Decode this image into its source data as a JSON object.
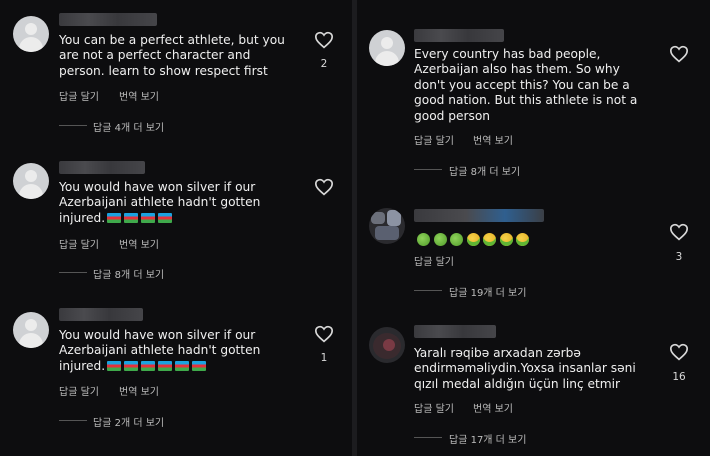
{
  "left_comments": [
    {
      "text": "You can be a perfect athlete, but you\nare not a perfect character and\nperson. learn to show respect first",
      "likes": "2",
      "reply_label": "답글 달기",
      "translate_label": "번역 보기",
      "more_replies": "답글 4개 더 보기"
    },
    {
      "text": "You would have won silver if our\nAzerbaijani athlete hadn't gotten\ninjured.",
      "flags_count": 4,
      "likes": "",
      "reply_label": "답글 달기",
      "translate_label": "번역 보기",
      "more_replies": "답글 8개 더 보기"
    },
    {
      "text": "You would have won silver if our\nAzerbaijani athlete hadn't gotten\ninjured.",
      "flags_count": 6,
      "likes": "1",
      "reply_label": "답글 달기",
      "translate_label": "번역 보기",
      "more_replies": "답글 2개 더 보기"
    }
  ],
  "right_comments": [
    {
      "text": "Every country has bad people,\nAzerbaijan also has them. So why\ndon't you accept this? You can be a\ngood nation. But this athlete is not a\ngood person",
      "likes": "",
      "reply_label": "답글 달기",
      "translate_label": "번역 보기",
      "more_replies": "답글 8개 더 보기"
    },
    {
      "emoji": [
        "green",
        "green",
        "green",
        "vomit",
        "vomit",
        "vomit",
        "vomit"
      ],
      "likes": "3",
      "reply_label": "답글 달기",
      "more_replies": "답글 19개 더 보기"
    },
    {
      "text": "Yaralı rəqibə arxadan zərbə\nendirməməliydin.Yoxsa insanlar səni\nqızıl medal aldığın üçün linç etmir",
      "likes": "16",
      "reply_label": "답글 달기",
      "translate_label": "번역 보기",
      "more_replies": "답글 17개 더 보기"
    }
  ],
  "colors": {
    "background": "#0d0d0f",
    "text": "#f0f0f0",
    "secondary_text": "#bdbdbd",
    "divider": "#1c1c1f"
  },
  "icons": {
    "like": "heart-outline-icon",
    "avatar": "default-user-icon"
  }
}
